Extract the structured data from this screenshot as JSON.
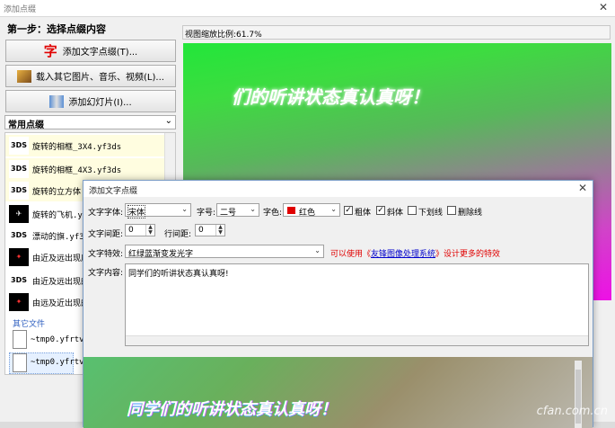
{
  "window": {
    "title": "添加点缀"
  },
  "step": {
    "title": "第一步：选择点缀内容"
  },
  "buttons": {
    "add_text_icon": "字",
    "add_text": "添加文字点缀(T)...",
    "load_media": "载入其它图片、音乐、视频(L)...",
    "add_slides": "添加幻灯片(I)..."
  },
  "category": {
    "label": "常用点缀"
  },
  "list": [
    {
      "thumb": "3DS",
      "label": "旋转的相框_3X4.yf3ds",
      "dark": false
    },
    {
      "thumb": "3DS",
      "label": "旋转的相框_4X3.yf3ds",
      "dark": false
    },
    {
      "thumb": "3DS",
      "label": "旋转的立方体",
      "dark": false
    },
    {
      "thumb": "✈",
      "label": "旋转的飞机.yf",
      "dark": true
    },
    {
      "thumb": "3DS",
      "label": "漂动的旗.yf3d",
      "dark": false
    },
    {
      "thumb": "✦",
      "label": "由近及远出现后",
      "dark": true
    },
    {
      "thumb": "3DS",
      "label": "由近及远出现的",
      "dark": false
    },
    {
      "thumb": "✦",
      "label": "由远及近出现的",
      "dark": true
    }
  ],
  "other_files": {
    "label": "其它文件",
    "files": [
      "~tmp0.yfrtv",
      "~tmp0.yfrtv"
    ]
  },
  "zoom": {
    "text": "视图缩放比例:61.7%"
  },
  "preview": {
    "text": "们的听讲状态真认真呀！"
  },
  "dialog": {
    "title": "添加文字点缀",
    "font_label": "文字字体:",
    "font_value": "宋体",
    "size_label": "字号:",
    "size_value": "二号",
    "color_label": "字色:",
    "color_value": "红色",
    "color_hex": "#e00000",
    "bold_label": "粗体",
    "italic_label": "斜体",
    "underline_label": "下划线",
    "strike_label": "删除线",
    "bold_checked": true,
    "italic_checked": true,
    "spacing_label": "文字间距:",
    "spacing_value": "0",
    "line_label": "行间距:",
    "line_value": "0",
    "effect_label": "文字特效:",
    "effect_value": "红绿蓝渐变发光字",
    "hint_pre": "可以使用《",
    "hint_link": "友锋图像处理系统",
    "hint_post": "》设计更多的特效",
    "content_label": "文字内容:",
    "content_value": "同学们的听讲状态真认真呀!",
    "preview_text": "同学们的听讲状态真认真呀！"
  },
  "watermark": "cfan.com.cn"
}
